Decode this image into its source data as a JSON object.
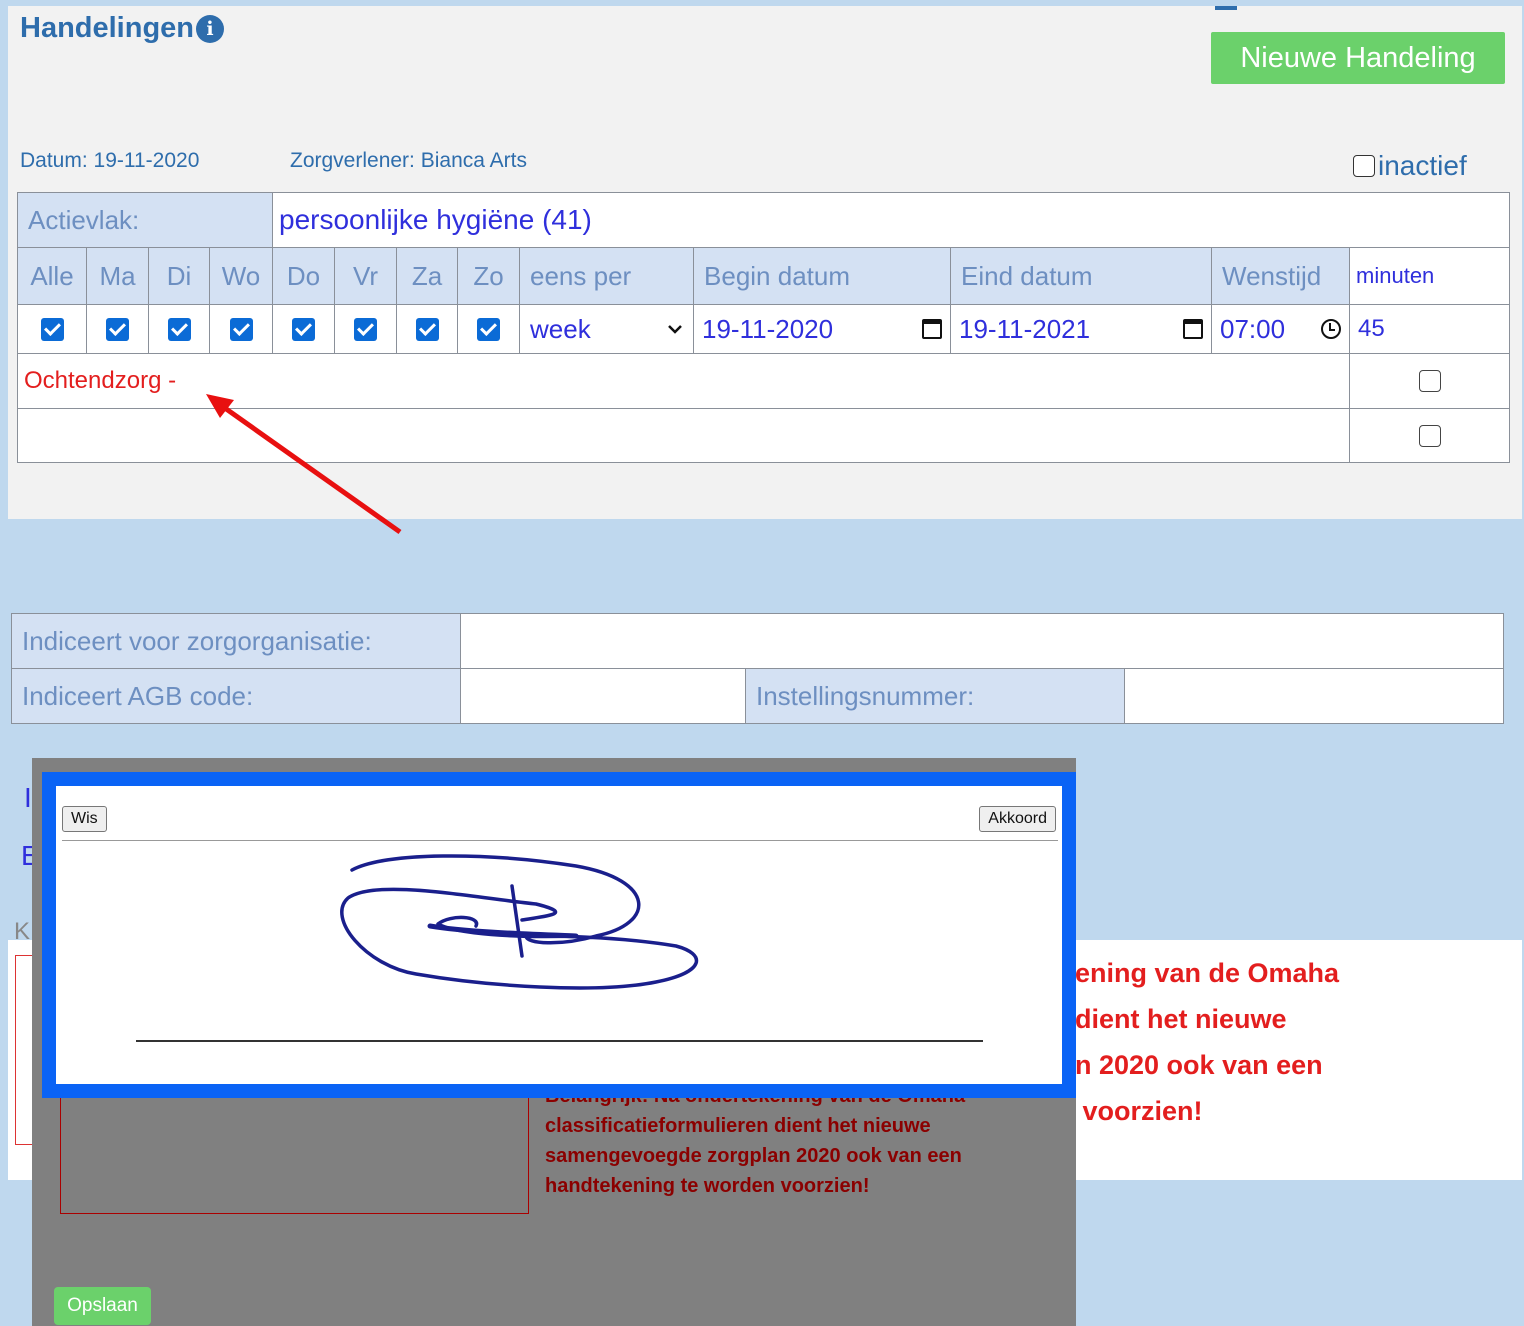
{
  "section_title": "Handelingen",
  "new_button": "Nieuwe Handeling",
  "meta": {
    "datum_label": "Datum:",
    "datum_value": "19-11-2020",
    "zorgverlener_label": "Zorgverlener:",
    "zorgverlener_value": "Bianca Arts",
    "inactief_label": "inactief"
  },
  "actievlak": {
    "label": "Actievlak:",
    "value": "persoonlijke hygiëne (41)"
  },
  "days": [
    "Alle",
    "Ma",
    "Di",
    "Wo",
    "Do",
    "Vr",
    "Za",
    "Zo"
  ],
  "columns": {
    "eens_per": "eens per",
    "begin": "Begin datum",
    "eind": "Eind datum",
    "wenstijd": "Wenstijd",
    "minuten": "minuten"
  },
  "row": {
    "eens_per": "week",
    "begin": "19-11-2020",
    "eind": "19-11-2021",
    "wenstijd": "07:00",
    "minuten": "45"
  },
  "handeling_text": "Ochtendzorg -",
  "indicatie": {
    "zorgorganisatie_label": "Indiceert voor zorgorganisatie:",
    "agb_label": "Indiceert AGB code:",
    "instelling_label": "Instellingsnummer:"
  },
  "fragments": {
    "h": "I",
    "b": "E",
    "k": "K"
  },
  "background_text": "ening van de Omaha\ndient het nieuwe\nn 2020 ook van een\n voorzien!",
  "dialog": {
    "wis": "Wis",
    "akkoord": "Akkoord",
    "text": "Belangrijk: Na ondertekening van de Omaha classificatieformulieren dient het nieuwe samengevoegde zorgplan 2020 ook van een handtekening te worden voorzien!",
    "save": "Opslaan"
  },
  "colors": {
    "accent_blue": "#2e6dac",
    "green_button": "#6bd16b",
    "signature_frame": "#0a63f5",
    "signature_ink": "#1a1f8c",
    "warning_red": "#e31e1e"
  }
}
